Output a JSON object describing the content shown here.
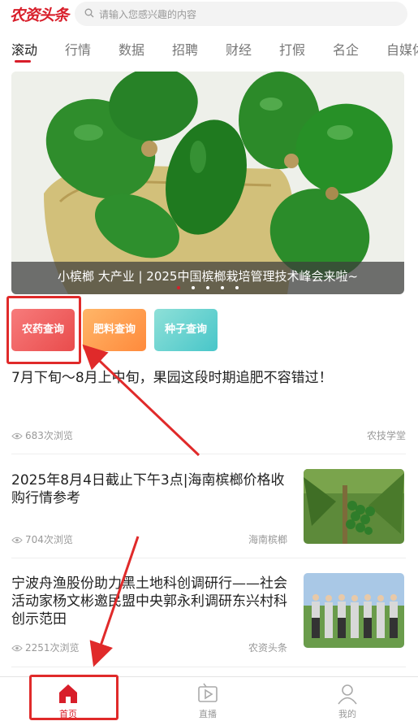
{
  "header": {
    "logo_text": "农资头条",
    "search_placeholder": "请输入您感兴趣的内容"
  },
  "tabs": [
    {
      "label": "滚动",
      "active": true
    },
    {
      "label": "行情"
    },
    {
      "label": "数据"
    },
    {
      "label": "招聘"
    },
    {
      "label": "财经"
    },
    {
      "label": "打假"
    },
    {
      "label": "名企"
    },
    {
      "label": "自媒体"
    }
  ],
  "banner": {
    "caption": "小槟榔 大产业 | 2025中国槟榔栽培管理技术峰会来啦~",
    "slide_count": 5,
    "active_index": 0
  },
  "quick_query": {
    "pesticide": "农药查询",
    "fertilizer": "肥料查询",
    "seed": "种子查询"
  },
  "articles": [
    {
      "title": "7月下旬～8月上中旬，果园这段时期追肥不容错过！",
      "views": "683次浏览",
      "source": "农技学堂"
    },
    {
      "title": "2025年8月4日截止下午3点|海南槟榔价格收购行情参考",
      "views": "704次浏览",
      "source": "海南槟榔"
    },
    {
      "title": "宁波舟渔股份助力黑土地科创调研行——社会活动家杨文彬邀民盟中央郭永利调研东兴村科创示范田",
      "views": "2251次浏览",
      "source": "农资头条"
    }
  ],
  "bottom_nav": [
    {
      "label": "首页",
      "icon": "home-icon",
      "active": true
    },
    {
      "label": "直播",
      "icon": "live-icon"
    },
    {
      "label": "我的",
      "icon": "profile-icon"
    }
  ],
  "colors": {
    "brand": "#d81e2a",
    "annotation": "#e02a2a"
  }
}
